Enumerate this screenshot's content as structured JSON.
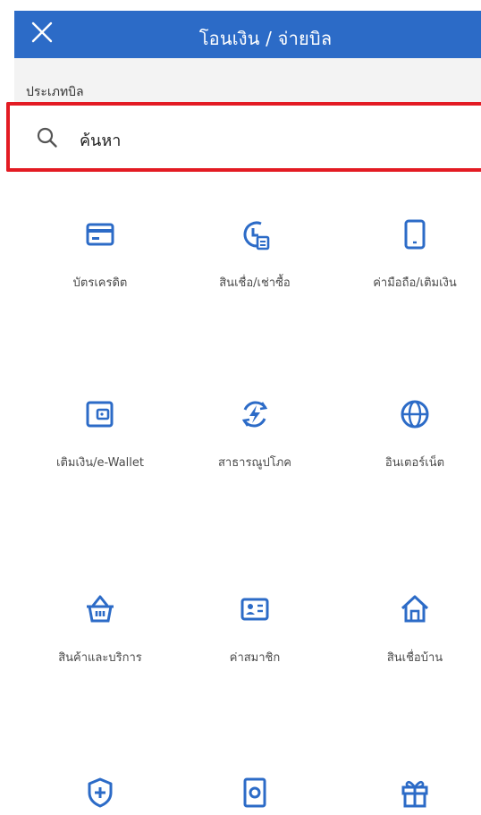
{
  "header": {
    "title": "โอนเงิน / จ่ายบิล",
    "close_icon": "close-icon"
  },
  "bill_type": {
    "label": "ประเภทบิล"
  },
  "search": {
    "placeholder": "ค้นหา",
    "icon": "search-icon"
  },
  "colors": {
    "header_bg": "#2c6bc7",
    "accent": "#2c6bc7",
    "highlight": "#e31b23"
  },
  "categories": [
    {
      "label": "บัตรเครดิต",
      "icon": "credit-card-icon"
    },
    {
      "label": "สินเชื่อ/เช่าซื้อ",
      "icon": "loan-clock-icon"
    },
    {
      "label": "ค่ามือถือ/เติมเงิน",
      "icon": "mobile-phone-icon"
    },
    {
      "label": "เติมเงิน/e-Wallet",
      "icon": "wallet-icon"
    },
    {
      "label": "สาธารณูปโภค",
      "icon": "utility-energy-icon"
    },
    {
      "label": "อินเตอร์เน็ต",
      "icon": "globe-icon"
    },
    {
      "label": "สินค้าและบริการ",
      "icon": "shopping-basket-icon"
    },
    {
      "label": "ค่าสมาชิก",
      "icon": "member-card-icon"
    },
    {
      "label": "สินเชื่อบ้าน",
      "icon": "home-icon"
    },
    {
      "label": "",
      "icon": "insurance-shield-icon"
    },
    {
      "label": "",
      "icon": "safe-box-icon"
    },
    {
      "label": "",
      "icon": "gift-icon"
    }
  ]
}
